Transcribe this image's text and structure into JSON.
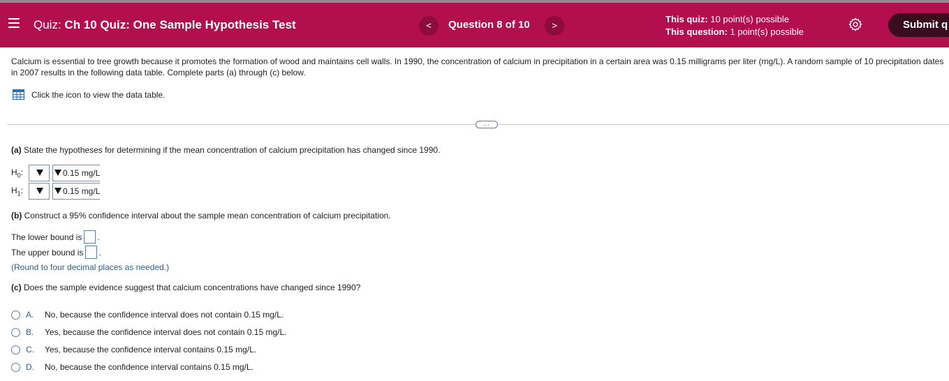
{
  "header": {
    "quiz_label": "Quiz:",
    "quiz_name": "Ch 10 Quiz: One Sample Hypothesis Test",
    "question_counter": "Question 8 of 10",
    "prev_glyph": "<",
    "next_glyph": ">",
    "quiz_points_label": "This quiz:",
    "quiz_points_value": "10 point(s) possible",
    "question_points_label": "This question:",
    "question_points_value": "1 point(s) possible",
    "submit_label": "Submit q",
    "accent_color": "#b30f4e"
  },
  "question": {
    "intro": "Calcium is essential to tree growth because it promotes the formation of wood and maintains cell walls. In 1990, the concentration of calcium in precipitation in a certain area was 0.15 milligrams per liter (mg/L). A random sample of 10 precipitation dates in 2007 results in the following data table. Complete parts (a) through (c) below.",
    "data_table_link": "Click the icon to view the data table.",
    "more_button": "…"
  },
  "part_a": {
    "tag": "(a)",
    "text": "State the hypotheses for determining if the mean concentration of calcium precipitation has changed since 1990.",
    "h0_label": "H",
    "h0_sub": "0",
    "h1_label": "H",
    "h1_sub": "1",
    "colon": ":",
    "h0_value": "0.15 mg/L",
    "h1_value": "0.15 mg/L"
  },
  "part_b": {
    "tag": "(b)",
    "text": "Construct a 95% confidence interval about the sample mean concentration of calcium precipitation.",
    "lower_label": "The lower bound is",
    "upper_label": "The upper bound is",
    "period": ".",
    "hint": "(Round to four decimal places as needed.)"
  },
  "part_c": {
    "tag": "(c)",
    "text": "Does the sample evidence suggest that calcium concentrations have changed since 1990?",
    "choices": [
      {
        "letter": "A.",
        "text": "No, because the confidence interval does not contain 0.15 mg/L."
      },
      {
        "letter": "B.",
        "text": "Yes, because the confidence interval does not contain 0.15 mg/L."
      },
      {
        "letter": "C.",
        "text": "Yes, because the confidence interval contains 0.15 mg/L."
      },
      {
        "letter": "D.",
        "text": "No, because the confidence interval contains 0.15 mg/L."
      }
    ]
  }
}
